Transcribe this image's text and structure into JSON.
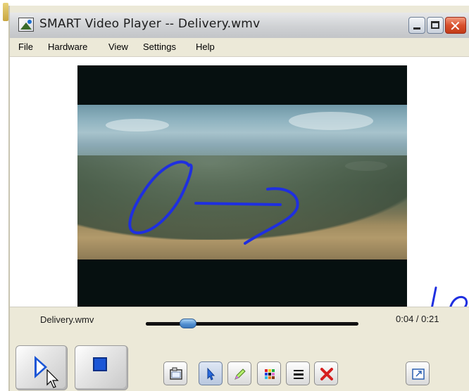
{
  "window": {
    "title": "SMART Video Player -- Delivery.wmv",
    "controls": {
      "minimize_icon": "minimize-icon",
      "maximize_icon": "maximize-icon",
      "close_label": "✕"
    }
  },
  "menu": {
    "items": [
      {
        "label": "File"
      },
      {
        "label": "Hardware"
      },
      {
        "label": "View"
      },
      {
        "label": "Settings"
      },
      {
        "label": "Help"
      }
    ]
  },
  "player": {
    "file_name": "Delivery.wmv",
    "time": "0:04 / 0:21",
    "progress_fraction": 0.2,
    "ink_color": "#1f2fe0"
  },
  "transport": {
    "play_icon": "play-icon",
    "stop_icon": "stop-icon"
  },
  "toolbar": {
    "tools": [
      {
        "icon": "capture-icon"
      },
      {
        "icon": "select-arrow-icon",
        "selected": true
      },
      {
        "icon": "pen-icon"
      },
      {
        "icon": "color-palette-icon"
      },
      {
        "icon": "line-width-icon"
      },
      {
        "icon": "delete-ink-icon"
      },
      {
        "icon": "fullscreen-icon"
      }
    ]
  },
  "colors": {
    "accent_blue": "#1b56d6",
    "delete_red": "#d61f1f"
  }
}
